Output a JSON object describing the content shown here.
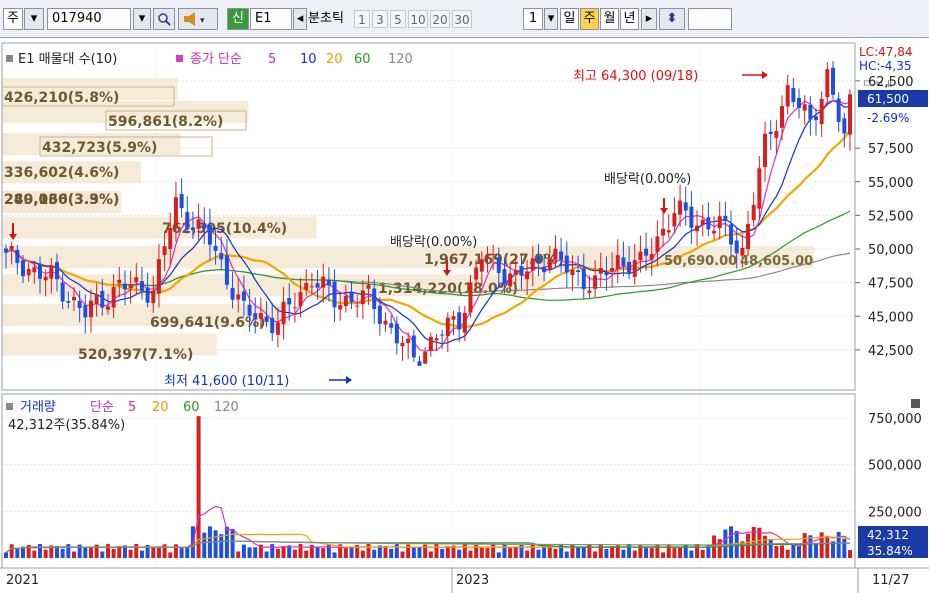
{
  "toolbar": {
    "period_select": "주",
    "stock_code": "017940",
    "new_badge": "신",
    "stock_name": "E1",
    "interval_labels": [
      "분",
      "초",
      "틱"
    ],
    "numbers": [
      "1",
      "3",
      "5",
      "10",
      "20",
      "30"
    ],
    "count_value": "1",
    "period_labels": [
      "일",
      "주",
      "월",
      "년"
    ],
    "active_period": "주"
  },
  "colors": {
    "up": "#d61f1f",
    "down": "#1f4fe0",
    "ma5": "#e030c0",
    "ma10": "#1030d0",
    "ma20": "#f0a800",
    "ma60": "#2a9a2a",
    "ma120": "#808080",
    "band": "#f5e6d2"
  },
  "price_panel": {
    "legend": {
      "title": "E1 매물대 수(10)",
      "ma_label": "종가 단순",
      "periods": [
        "5",
        "10",
        "20",
        "60",
        "120"
      ]
    },
    "y_ticks": [
      "62,500",
      "57,500",
      "55,000",
      "52,500",
      "50,000",
      "47,500",
      "45,000",
      "42,500"
    ],
    "info_lc": "LC:47,84",
    "info_hc": "HC:-4,35",
    "info_hidden": "ㄷ-ㅂ.Ⅱ",
    "current_price": "61,500",
    "current_change": "-2.69%",
    "annotations": {
      "high": "최고 64,300 (09/18)",
      "low": "최저 41,600 (10/11)",
      "dividend": "배당락(0.00%)"
    },
    "volume_profile": [
      {
        "label": "426,210(5.8%)"
      },
      {
        "label": "596,861(8.2%)"
      },
      {
        "label": "432,723(5.9%)"
      },
      {
        "label": "336,602(4.6%)"
      },
      {
        "label": "289,060(3.9%)"
      },
      {
        "label": "240,136(3.3%)"
      },
      {
        "label": "762,505(10.4%)"
      },
      {
        "label": "1,967,169(27.0%)"
      },
      {
        "label": "1,314,220(18.0%)"
      },
      {
        "label": "699,641(9.6%)"
      },
      {
        "label": "520,397(7.1%)"
      }
    ],
    "extra_labels": [
      "50,690.00",
      "48,605.00"
    ]
  },
  "volume_panel": {
    "legend": {
      "title": "거래량",
      "ma_label": "단순",
      "periods": [
        "5",
        "20",
        "60",
        "120"
      ]
    },
    "current_label": "42,312주(35.84%)",
    "y_ticks": [
      "750,000",
      "500,000",
      "250,000"
    ],
    "current_volume": "42,312",
    "current_percent": "35.84%"
  },
  "x_axis": {
    "labels": [
      "2021",
      "2023",
      "11/27"
    ]
  },
  "chart_data": {
    "type": "candlestick",
    "price_range": [
      41000,
      64800
    ],
    "volume_range": [
      0,
      900000
    ],
    "ohlc_series": "weekly candles, 2021 to 11/27/2023",
    "summary": {
      "high": 64300,
      "high_date": "09/18",
      "low": 41600,
      "low_date": "10/11",
      "last_close": 61500
    },
    "volume_profile_bins": [
      {
        "price": 61900,
        "volume": 426210,
        "pct": 5.8
      },
      {
        "price": 60200,
        "volume": 596861,
        "pct": 8.2
      },
      {
        "price": 57800,
        "volume": 432723,
        "pct": 5.9
      },
      {
        "price": 55700,
        "volume": 336602,
        "pct": 4.6
      },
      {
        "price": 53500,
        "volume": 289060,
        "pct": 3.9
      },
      {
        "price": 53500,
        "volume": 240136,
        "pct": 3.3
      },
      {
        "price": 51600,
        "volume": 762505,
        "pct": 10.4
      },
      {
        "price": 49400,
        "volume": 1967169,
        "pct": 27.0
      },
      {
        "price": 47300,
        "volume": 1314220,
        "pct": 18.0
      },
      {
        "price": 45100,
        "volume": 699641,
        "pct": 9.6
      },
      {
        "price": 42900,
        "volume": 520397,
        "pct": 7.1
      }
    ],
    "series": [
      {
        "name": "5"
      },
      {
        "name": "10"
      },
      {
        "name": "20"
      },
      {
        "name": "60"
      },
      {
        "name": "120"
      }
    ],
    "volume_series": [
      {
        "name": "거래량"
      },
      {
        "name": "5"
      },
      {
        "name": "20"
      },
      {
        "name": "60"
      },
      {
        "name": "120"
      }
    ]
  }
}
